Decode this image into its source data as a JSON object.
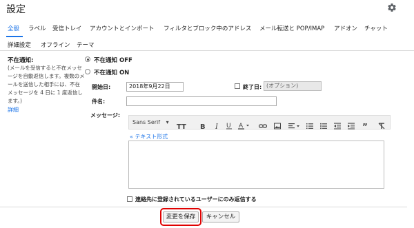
{
  "header": {
    "title": "設定"
  },
  "tabs": [
    {
      "label": "全般"
    },
    {
      "label": "ラベル"
    },
    {
      "label": "受信トレイ"
    },
    {
      "label": "アカウントとインポート"
    },
    {
      "label": "フィルタとブロック中のアドレス"
    },
    {
      "label": "メール転送と POP/IMAP"
    },
    {
      "label": "アドオン"
    },
    {
      "label": "チャット"
    },
    {
      "label": "詳細設定"
    },
    {
      "label": "オフライン"
    },
    {
      "label": "テーマ"
    }
  ],
  "vacation": {
    "title": "不在通知:",
    "description": "(メールを受信すると不在メッセージを自動返信します。複数のメールを送信した相手には、不在メッセージを 4 日に 1 度返信します。)",
    "details_link": "詳細",
    "off_label": "不在通知 OFF",
    "on_label": "不在通知 ON",
    "selected": "off",
    "start_label": "開始日:",
    "start_value": "2018年9月22日",
    "end_label": "終了日:",
    "end_placeholder": "(オプション)",
    "subject_label": "件名:",
    "message_label": "メッセージ:",
    "font_name": "Sans Serif",
    "plain_text_link": "« テキスト形式",
    "contacts_only_label": "連絡先に登録されているユーザーにのみ返信する"
  },
  "icons": {
    "settings": "gear-icon",
    "text_size": "text-size-icon",
    "bold": "bold-icon",
    "italic": "italic-icon",
    "underline": "underline-icon",
    "text_color": "text-color-icon",
    "link": "link-icon",
    "image": "image-icon",
    "align": "align-icon",
    "numbered_list": "numbered-list-icon",
    "bulleted_list": "bulleted-list-icon",
    "indent_less": "indent-less-icon",
    "indent_more": "indent-more-icon",
    "quote": "quote-icon",
    "remove_formatting": "remove-formatting-icon"
  },
  "buttons": {
    "save": "変更を保存",
    "cancel": "キャンセル"
  },
  "colors": {
    "accent": "#1a73e8",
    "highlight": "#e00000"
  }
}
